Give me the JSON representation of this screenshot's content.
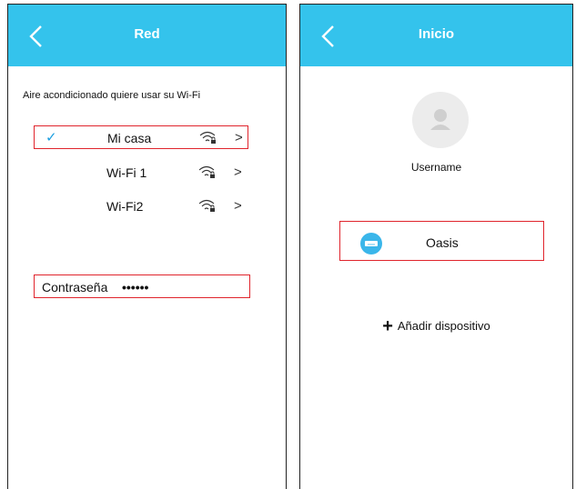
{
  "left_screen": {
    "header": {
      "title": "Red"
    },
    "prompt": "Aire acondicionado quiere usar su Wi-Fi",
    "networks": [
      {
        "name": "Mi casa",
        "selected_mark": "✓",
        "chevron": ">",
        "icon": "wifi-lock-icon"
      },
      {
        "name": "Wi-Fi 1",
        "selected_mark": "",
        "chevron": ">",
        "icon": "wifi-lock-icon"
      },
      {
        "name": "Wi-Fi2",
        "selected_mark": "",
        "chevron": ">",
        "icon": "wifi-lock-icon"
      }
    ],
    "password": {
      "label": "Contraseña",
      "value": "••••••"
    }
  },
  "right_screen": {
    "header": {
      "title": "Inicio"
    },
    "username": "Username",
    "device": {
      "name": "Oasis",
      "icon": "air-conditioner-icon"
    },
    "add_device": {
      "plus": "+",
      "label": "Añadir dispositivo"
    }
  },
  "colors": {
    "header": "#34c3ec",
    "highlight": "#e0242c",
    "check": "#1a9ee0",
    "device_icon": "#3ab6ea"
  }
}
